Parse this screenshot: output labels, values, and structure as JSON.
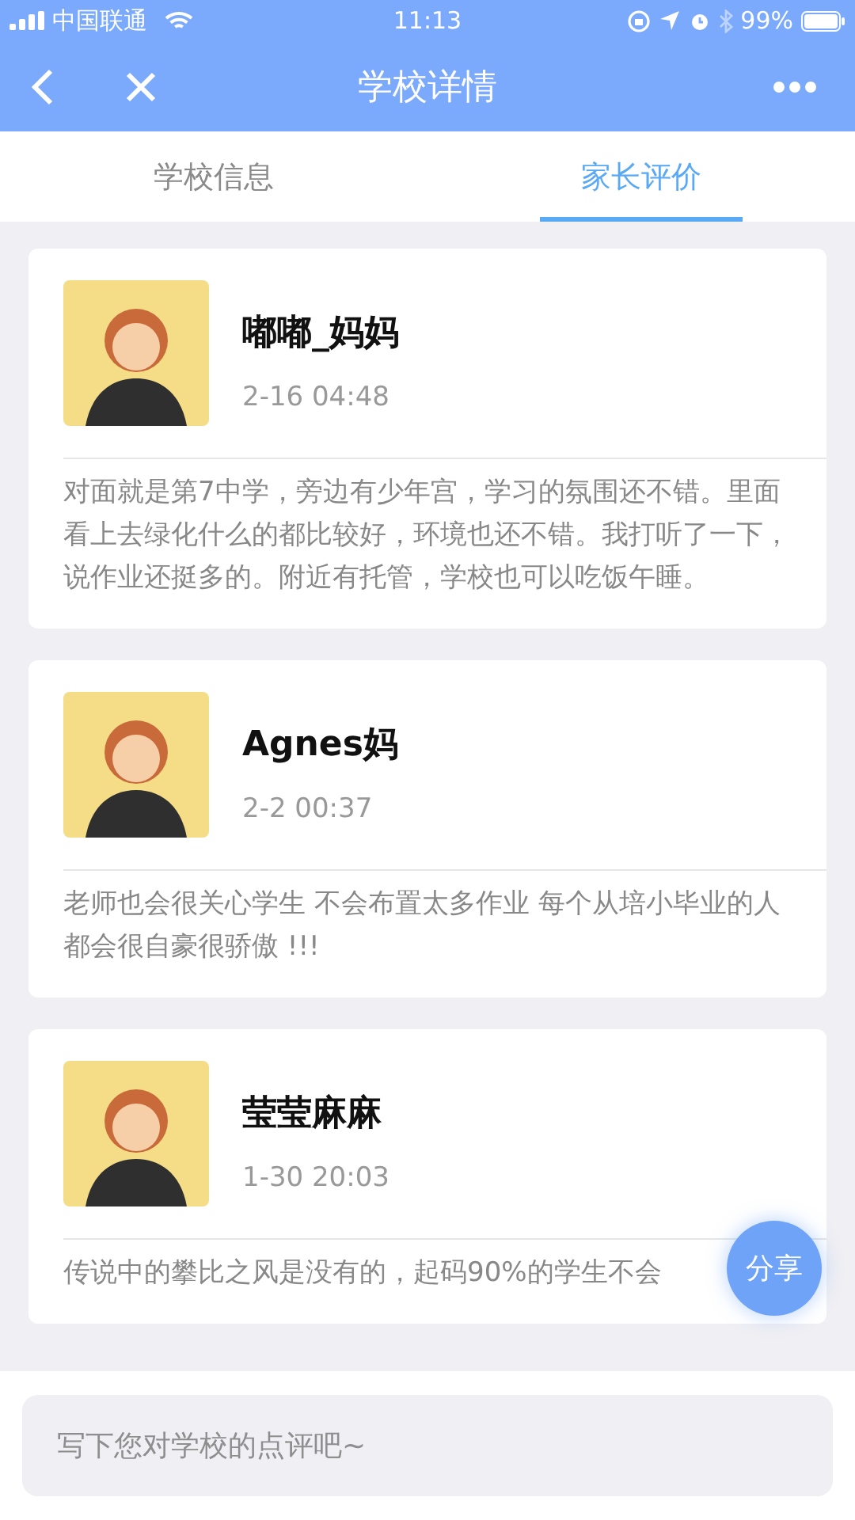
{
  "status_bar": {
    "carrier": "中国联通",
    "time": "11:13",
    "battery": "99%"
  },
  "nav": {
    "title": "学校详情"
  },
  "tabs": [
    {
      "label": "学校信息",
      "selected": false
    },
    {
      "label": "家长评价",
      "selected": true
    }
  ],
  "reviews": [
    {
      "name": "嘟嘟_妈妈",
      "time": "2-16 04:48",
      "text": "对面就是第7中学，旁边有少年宫，学习的氛围还不错。里面看上去绿化什么的都比较好，环境也还不错。我打听了一下，说作业还挺多的。附近有托管，学校也可以吃饭午睡。"
    },
    {
      "name": "Agnes妈",
      "time": "2-2 00:37",
      "text": "老师也会很关心学生 不会布置太多作业 每个从培小毕业的人都会很自豪很骄傲 !!!"
    },
    {
      "name": "莹莹麻麻",
      "time": "1-30 20:03",
      "text": "传说中的攀比之风是没有的，起码90%的学生不会"
    }
  ],
  "share_button": "分享",
  "comment": {
    "placeholder": "写下您对学校的点评吧~"
  }
}
